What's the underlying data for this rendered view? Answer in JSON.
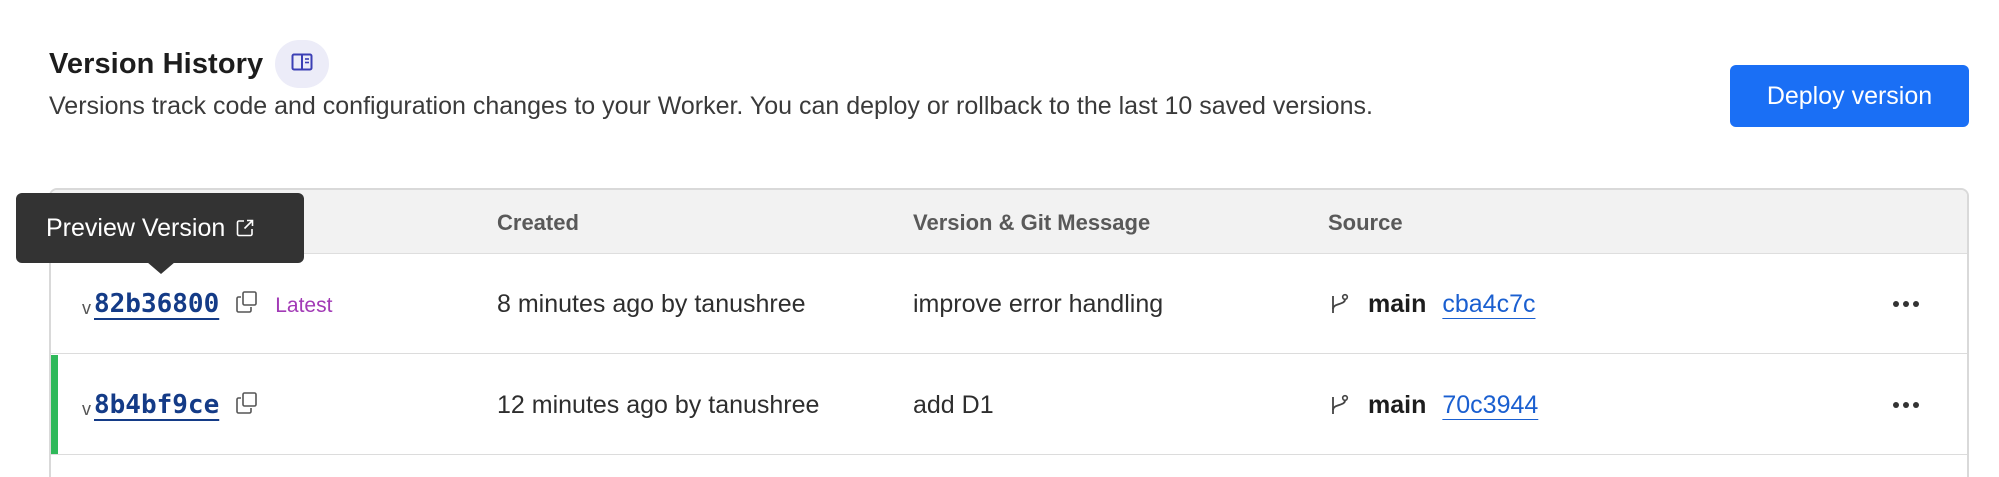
{
  "header": {
    "title": "Version History",
    "subtitle": "Versions track code and configuration changes to your Worker. You can deploy or rollback to the last 10 saved versions.",
    "docs_icon": "book-icon",
    "deploy_label": "Deploy version",
    "accent_color": "#1a6ff5"
  },
  "tooltip": {
    "label": "Preview Version",
    "icon": "external-link-icon"
  },
  "table": {
    "columns": [
      "Created",
      "Version & Git Message",
      "Source"
    ],
    "rows": [
      {
        "v_prefix": "v",
        "version_id": "82b36800",
        "badge": "Latest",
        "created": "8 minutes ago by tanushree",
        "message": "improve error handling",
        "branch": "main",
        "commit": "cba4c7c"
      },
      {
        "v_prefix": "v",
        "version_id": "8b4bf9ce",
        "badge": "",
        "created": "12 minutes ago by tanushree",
        "message": "add D1",
        "branch": "main",
        "commit": "70c3944"
      }
    ],
    "active_indicator_color": "#2fb95a"
  }
}
